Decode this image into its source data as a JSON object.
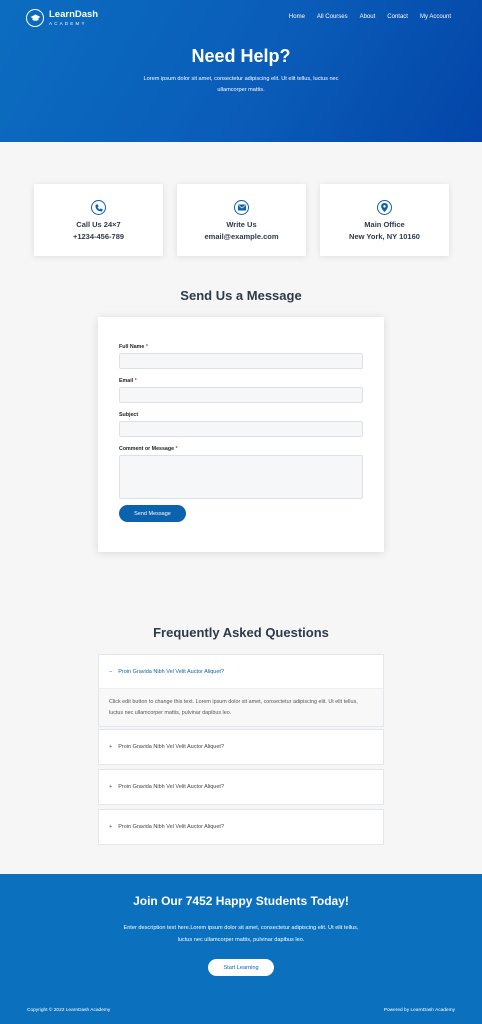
{
  "header": {
    "logo_name": "LearnDash",
    "logo_sub": "ACADEMY",
    "nav": [
      "Home",
      "All Courses",
      "About",
      "Contact",
      "My Account"
    ]
  },
  "hero": {
    "title": "Need Help?",
    "description": "Lorem ipsum dolor sit amet, consectetur adipiscing elit. Ut elit tellus, luctus nec ullamcorper mattis."
  },
  "contact_cards": [
    {
      "icon": "phone-icon",
      "title": "Call Us 24×7",
      "value": "+1234-456-789"
    },
    {
      "icon": "envelope-icon",
      "title": "Write Us",
      "value": "email@example.com"
    },
    {
      "icon": "location-pin-icon",
      "title": "Main Office",
      "value": "New York, NY 10160"
    }
  ],
  "form": {
    "title": "Send Us a Message",
    "fields": [
      {
        "label": "Full Name",
        "required": "*",
        "value": ""
      },
      {
        "label": "Email",
        "required": "*",
        "value": ""
      },
      {
        "label": "Subject",
        "required": "",
        "value": ""
      },
      {
        "label": "Comment or Message",
        "required": "*",
        "value": ""
      }
    ],
    "submit": "Send Message"
  },
  "faq": {
    "title": "Frequently Asked Questions",
    "items": [
      {
        "question": "Proin Gravida Nibh Vel Velit Auctor Aliquet?",
        "open": true,
        "answer": "Click edit button to change this text. Lorem ipsum dolor sit amet, consectetur adipiscing elit. Ut elit tellus, luctus nec ullamcorper mattis, pulvinar dapibus leo."
      },
      {
        "question": "Proin Gravida Nibh Vel Velit Auctor Aliquet?",
        "open": false
      },
      {
        "question": "Proin Gravida Nibh Vel Velit Auctor Aliquet?",
        "open": false
      },
      {
        "question": "Proin Gravida Nibh Vel Velit Auctor Aliquet?",
        "open": false
      }
    ]
  },
  "cta": {
    "title": "Join Our 7452 Happy Students Today!",
    "description": "Enter description text here.Lorem ipsum dolor sit amet, consectetur adipiscing elit. Ut elit tellus, luctus nec ullamcorper mattis, pulvinar dapibus leo.",
    "button": "Start Learning"
  },
  "footer": {
    "copyright": "Copyright © 2022 LearnDash Academy",
    "powered": "Powered by LearnDash Academy"
  },
  "colors": {
    "primary": "#0b62ad",
    "hero_dark": "#0345a8",
    "cta": "#0b70bd"
  }
}
